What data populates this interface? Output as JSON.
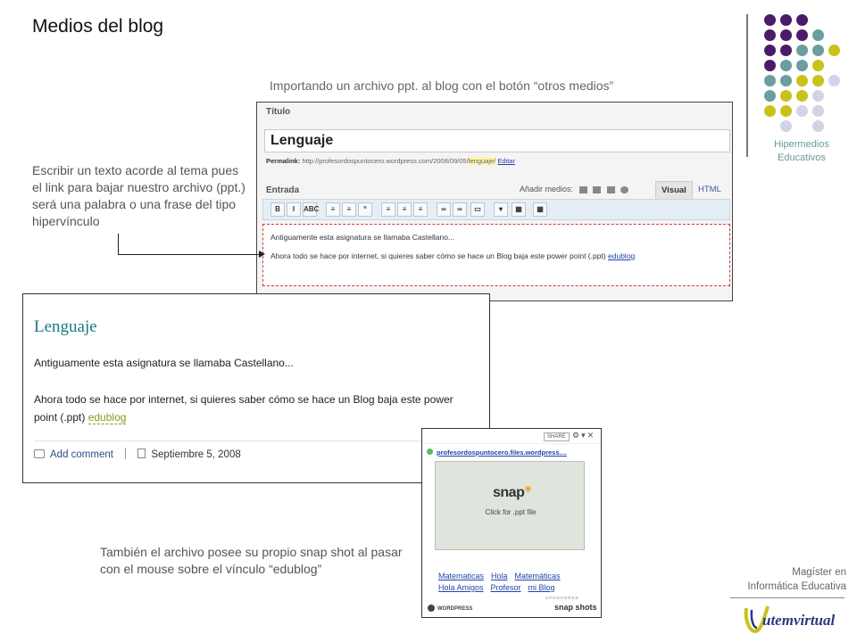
{
  "slide": {
    "title": "Medios del blog",
    "caption_top": "Importando un archivo ppt. al blog con el botón “otros medios”",
    "caption_left": "Escribir un texto acorde al tema pues el link para bajar nuestro archivo (ppt.) será una palabra o una frase del tipo hipervínculo",
    "caption_bottom": "También el archivo posee su propio snap shot al pasar con el mouse sobre el vínculo “edublog”"
  },
  "brand": {
    "line1": "Hipermedios",
    "line2": "Educativos",
    "colors": {
      "purple": "#4b1a6b",
      "teal": "#6a9ea0",
      "lime": "#c9c21a",
      "lavender": "#d3d3e8"
    }
  },
  "footer": {
    "line1": "Magíster en",
    "line2": "Informática Educativa",
    "logo_text": "utemvirtual"
  },
  "editor": {
    "title_label": "Título",
    "title_value": "Lenguaje",
    "permalink_label": "Permalink:",
    "permalink_url": "http://profesordospuntocero.wordpress.com/2008/09/05/",
    "permalink_slug": "lenguaje/",
    "permalink_edit": "Editar",
    "entry_label": "Entrada",
    "media_label": "Añadir medios:",
    "tab_visual": "Visual",
    "tab_html": "HTML",
    "toolbar_buttons": [
      "B",
      "I",
      "ABC",
      "≡",
      "≡",
      "“",
      "≡",
      "≡",
      "≡",
      "∞",
      "∞",
      "▭",
      "▾",
      "▦",
      "▦"
    ],
    "body_line1": "Antiguamente esta asignatura se llamaba Castellano...",
    "body_line2": "Ahora todo se hace por internet, si quieres saber cómo se hace un Blog baja este power point (.ppt) ",
    "body_link": "edublog"
  },
  "post": {
    "title": "Lenguaje",
    "p1": "Antiguamente esta asignatura se llamaba Castellano...",
    "p2": "Ahora todo se hace por internet, si quieres saber cómo se hace un Blog baja este power point (.ppt) ",
    "link": "edublog",
    "add_comment": "Add comment",
    "date": "Septiembre 5, 2008"
  },
  "snap": {
    "share": "SHARE",
    "url": "profesordospuntocero.files.wordpress....",
    "logo": "snap",
    "click_text": "Click for .ppt file",
    "links": [
      "Matematicas",
      "Hola",
      "Matemáticas",
      "Hola Amigos",
      "Profesor",
      "mi Blog"
    ],
    "sponsored": "SPONSORED",
    "wordpress": "WORDPRESS",
    "brand": "snap shots"
  }
}
